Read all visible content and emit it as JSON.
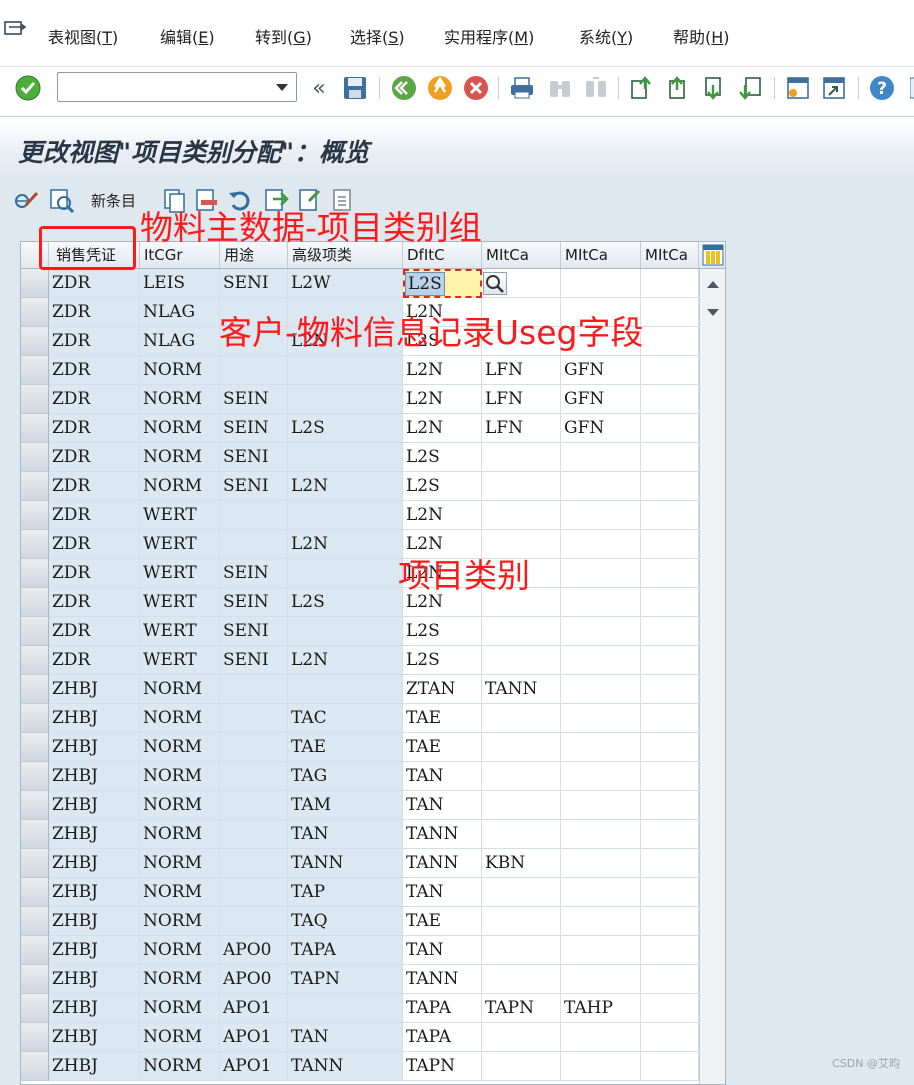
{
  "menubar": {
    "items": [
      {
        "label": "表视图(",
        "key": "T",
        "end": ")"
      },
      {
        "label": "编辑(",
        "key": "E",
        "end": ")"
      },
      {
        "label": "转到(",
        "key": "G",
        "end": ")"
      },
      {
        "label": "选择(",
        "key": "S",
        "end": ")"
      },
      {
        "label": "实用程序(",
        "key": "M",
        "end": ")"
      },
      {
        "label": "系统(",
        "key": "Y",
        "end": ")"
      },
      {
        "label": "帮助(",
        "key": "H",
        "end": ")"
      }
    ]
  },
  "toolbar": {
    "command_value": "",
    "back_glyph": "«"
  },
  "title": "更改视图\"项目类别分配\"：概览",
  "app_toolbar": {
    "new_entries_label": "新条目"
  },
  "grid": {
    "columns": [
      "销售凭证",
      "ItCGr",
      "用途",
      "高级项类",
      "DfItC",
      "MItCa",
      "MItCa",
      "MItCa"
    ],
    "active_value": "L2S",
    "rows": [
      [
        "ZDR",
        "LEIS",
        "SENI",
        "L2W",
        "L2S",
        "",
        "",
        ""
      ],
      [
        "ZDR",
        "NLAG",
        "",
        "",
        "L2N",
        "",
        "",
        ""
      ],
      [
        "ZDR",
        "NLAG",
        "",
        "L2N",
        "L2S",
        "",
        "",
        ""
      ],
      [
        "ZDR",
        "NORM",
        "",
        "",
        "L2N",
        "LFN",
        "GFN",
        ""
      ],
      [
        "ZDR",
        "NORM",
        "SEIN",
        "",
        "L2N",
        "LFN",
        "GFN",
        ""
      ],
      [
        "ZDR",
        "NORM",
        "SEIN",
        "L2S",
        "L2N",
        "LFN",
        "GFN",
        ""
      ],
      [
        "ZDR",
        "NORM",
        "SENI",
        "",
        "L2S",
        "",
        "",
        ""
      ],
      [
        "ZDR",
        "NORM",
        "SENI",
        "L2N",
        "L2S",
        "",
        "",
        ""
      ],
      [
        "ZDR",
        "WERT",
        "",
        "",
        "L2N",
        "",
        "",
        ""
      ],
      [
        "ZDR",
        "WERT",
        "",
        "L2N",
        "L2N",
        "",
        "",
        ""
      ],
      [
        "ZDR",
        "WERT",
        "SEIN",
        "",
        "L2N",
        "",
        "",
        ""
      ],
      [
        "ZDR",
        "WERT",
        "SEIN",
        "L2S",
        "L2N",
        "",
        "",
        ""
      ],
      [
        "ZDR",
        "WERT",
        "SENI",
        "",
        "L2S",
        "",
        "",
        ""
      ],
      [
        "ZDR",
        "WERT",
        "SENI",
        "L2N",
        "L2S",
        "",
        "",
        ""
      ],
      [
        "ZHBJ",
        "NORM",
        "",
        "",
        "ZTAN",
        "TANN",
        "",
        ""
      ],
      [
        "ZHBJ",
        "NORM",
        "",
        "TAC",
        "TAE",
        "",
        "",
        ""
      ],
      [
        "ZHBJ",
        "NORM",
        "",
        "TAE",
        "TAE",
        "",
        "",
        ""
      ],
      [
        "ZHBJ",
        "NORM",
        "",
        "TAG",
        "TAN",
        "",
        "",
        ""
      ],
      [
        "ZHBJ",
        "NORM",
        "",
        "TAM",
        "TAN",
        "",
        "",
        ""
      ],
      [
        "ZHBJ",
        "NORM",
        "",
        "TAN",
        "TANN",
        "",
        "",
        ""
      ],
      [
        "ZHBJ",
        "NORM",
        "",
        "TANN",
        "TANN",
        "KBN",
        "",
        ""
      ],
      [
        "ZHBJ",
        "NORM",
        "",
        "TAP",
        "TAN",
        "",
        "",
        ""
      ],
      [
        "ZHBJ",
        "NORM",
        "",
        "TAQ",
        "TAE",
        "",
        "",
        ""
      ],
      [
        "ZHBJ",
        "NORM",
        "APO0",
        "TAPA",
        "TAN",
        "",
        "",
        ""
      ],
      [
        "ZHBJ",
        "NORM",
        "APO0",
        "TAPN",
        "TANN",
        "",
        "",
        ""
      ],
      [
        "ZHBJ",
        "NORM",
        "APO1",
        "",
        "TAPA",
        "TAPN",
        "TAHP",
        ""
      ],
      [
        "ZHBJ",
        "NORM",
        "APO1",
        "TAN",
        "TAPA",
        "",
        "",
        ""
      ],
      [
        "ZHBJ",
        "NORM",
        "APO1",
        "TANN",
        "TAPN",
        "",
        "",
        ""
      ]
    ]
  },
  "annotations": {
    "material_group": "物料主数据-项目类别组",
    "usage_field": "客户-物料信息记录Useg字段",
    "item_category": "项目类别"
  },
  "watermark": "CSDN @艾昀"
}
